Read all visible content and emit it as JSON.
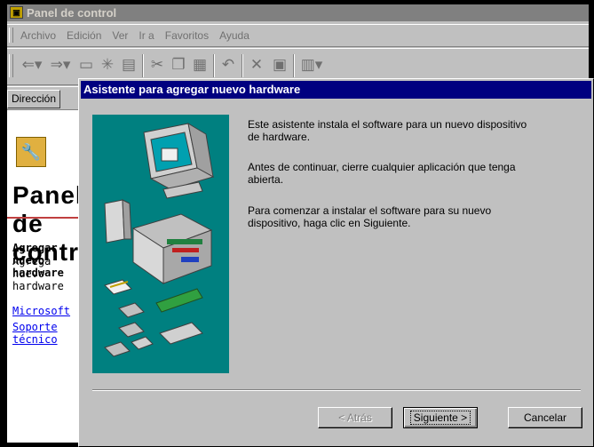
{
  "window": {
    "title": "Panel de control",
    "menu": [
      "Archivo",
      "Edición",
      "Ver",
      "Ir a",
      "Favoritos",
      "Ayuda"
    ],
    "toolbar_icons": [
      "back-arrow-icon",
      "forward-arrow-icon",
      "up-folder-icon",
      "cut-icon",
      "copy-icon",
      "paste-icon",
      "undo-icon",
      "delete-icon",
      "properties-icon",
      "views-icon"
    ],
    "address_label": "Dirección"
  },
  "content": {
    "heading": "Panel de control",
    "item_title": "Agregar nuevo hardware",
    "item_desc": "Agrega nuevo hardware",
    "link1": "Microsoft",
    "link2": "Soporte técnico"
  },
  "dialog": {
    "title": "Asistente para agregar nuevo hardware",
    "para1": "Este asistente instala el software para un nuevo dispositivo de hardware.",
    "para2": "Antes de continuar, cierre cualquier aplicación que tenga abierta.",
    "para3": "Para comenzar a instalar el software para su nuevo dispositivo, haga clic en Siguiente.",
    "back": "< Atrás",
    "next": "Siguiente >",
    "cancel": "Cancelar"
  },
  "colors": {
    "title_active": "#000080",
    "title_inactive": "#808080",
    "art_bg": "#008080",
    "face": "#c0c0c0"
  }
}
